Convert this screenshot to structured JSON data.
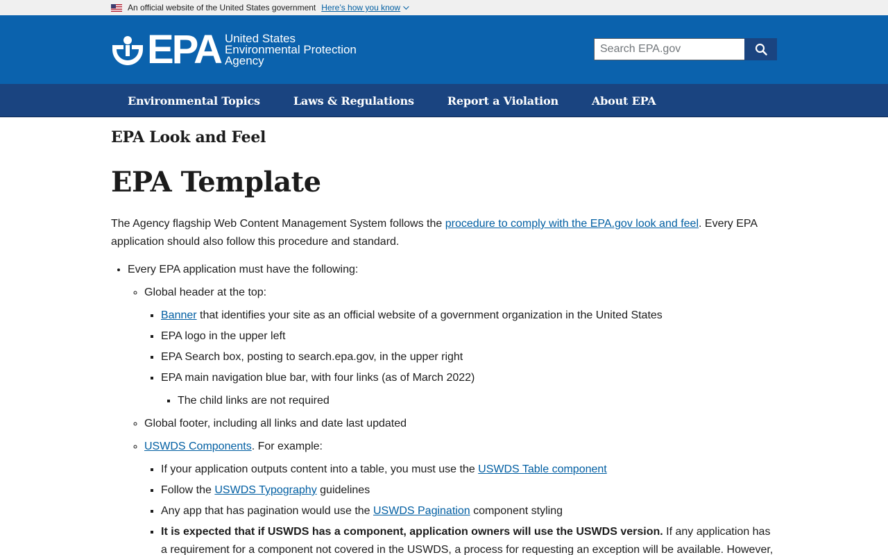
{
  "gov_banner": {
    "text": "An official website of the United States government",
    "link": "Here’s how you know"
  },
  "header": {
    "logo_wordmark": "EPA",
    "agency_line1": "United States",
    "agency_line2": "Environmental Protection",
    "agency_line3": "Agency",
    "search_placeholder": "Search EPA.gov"
  },
  "nav": {
    "items": [
      "Environmental Topics",
      "Laws & Regulations",
      "Report a Violation",
      "About EPA"
    ]
  },
  "content": {
    "section_title": "EPA Look and Feel",
    "page_title": "EPA Template",
    "intro_before": "The Agency flagship Web Content Management System follows the ",
    "intro_link": "procedure to comply with the EPA.gov look and feel",
    "intro_after": ". Every EPA application should also follow this procedure and standard.",
    "must_have": "Every EPA application must have the following:",
    "global_header": "Global header at the top:",
    "banner_link": "Banner",
    "banner_rest": " that identifies your site as an official website of a government organization in the United States",
    "logo_item": "EPA logo in the upper left",
    "search_item": "EPA Search box, posting to search.epa.gov, in the upper right",
    "nav_item": "EPA main navigation blue bar, with four links (as of March 2022)",
    "child_links": "The child links are not required",
    "global_footer": "Global footer, including all links and date last updated",
    "uswds_link": "USWDS Components",
    "uswds_rest": ". For example:",
    "table_before": "If your application outputs content into a table, you must use the ",
    "table_link": "USWDS Table component",
    "typo_before": "Follow the ",
    "typo_link": "USWDS Typography",
    "typo_after": " guidelines",
    "pag_before": "Any app that has pagination would use the ",
    "pag_link": "USWDS Pagination",
    "pag_after": " component styling",
    "expected_bold": "It is expected that if USWDS has a component, application owners will use the USWDS version.",
    "expected_rest": " If any application has a requirement for a component not covered in the USWDS, a process for requesting an exception will be available. However,"
  },
  "colors": {
    "header_blue": "#0b62ad",
    "nav_blue": "#1a4480",
    "link_blue": "#005ea2"
  }
}
